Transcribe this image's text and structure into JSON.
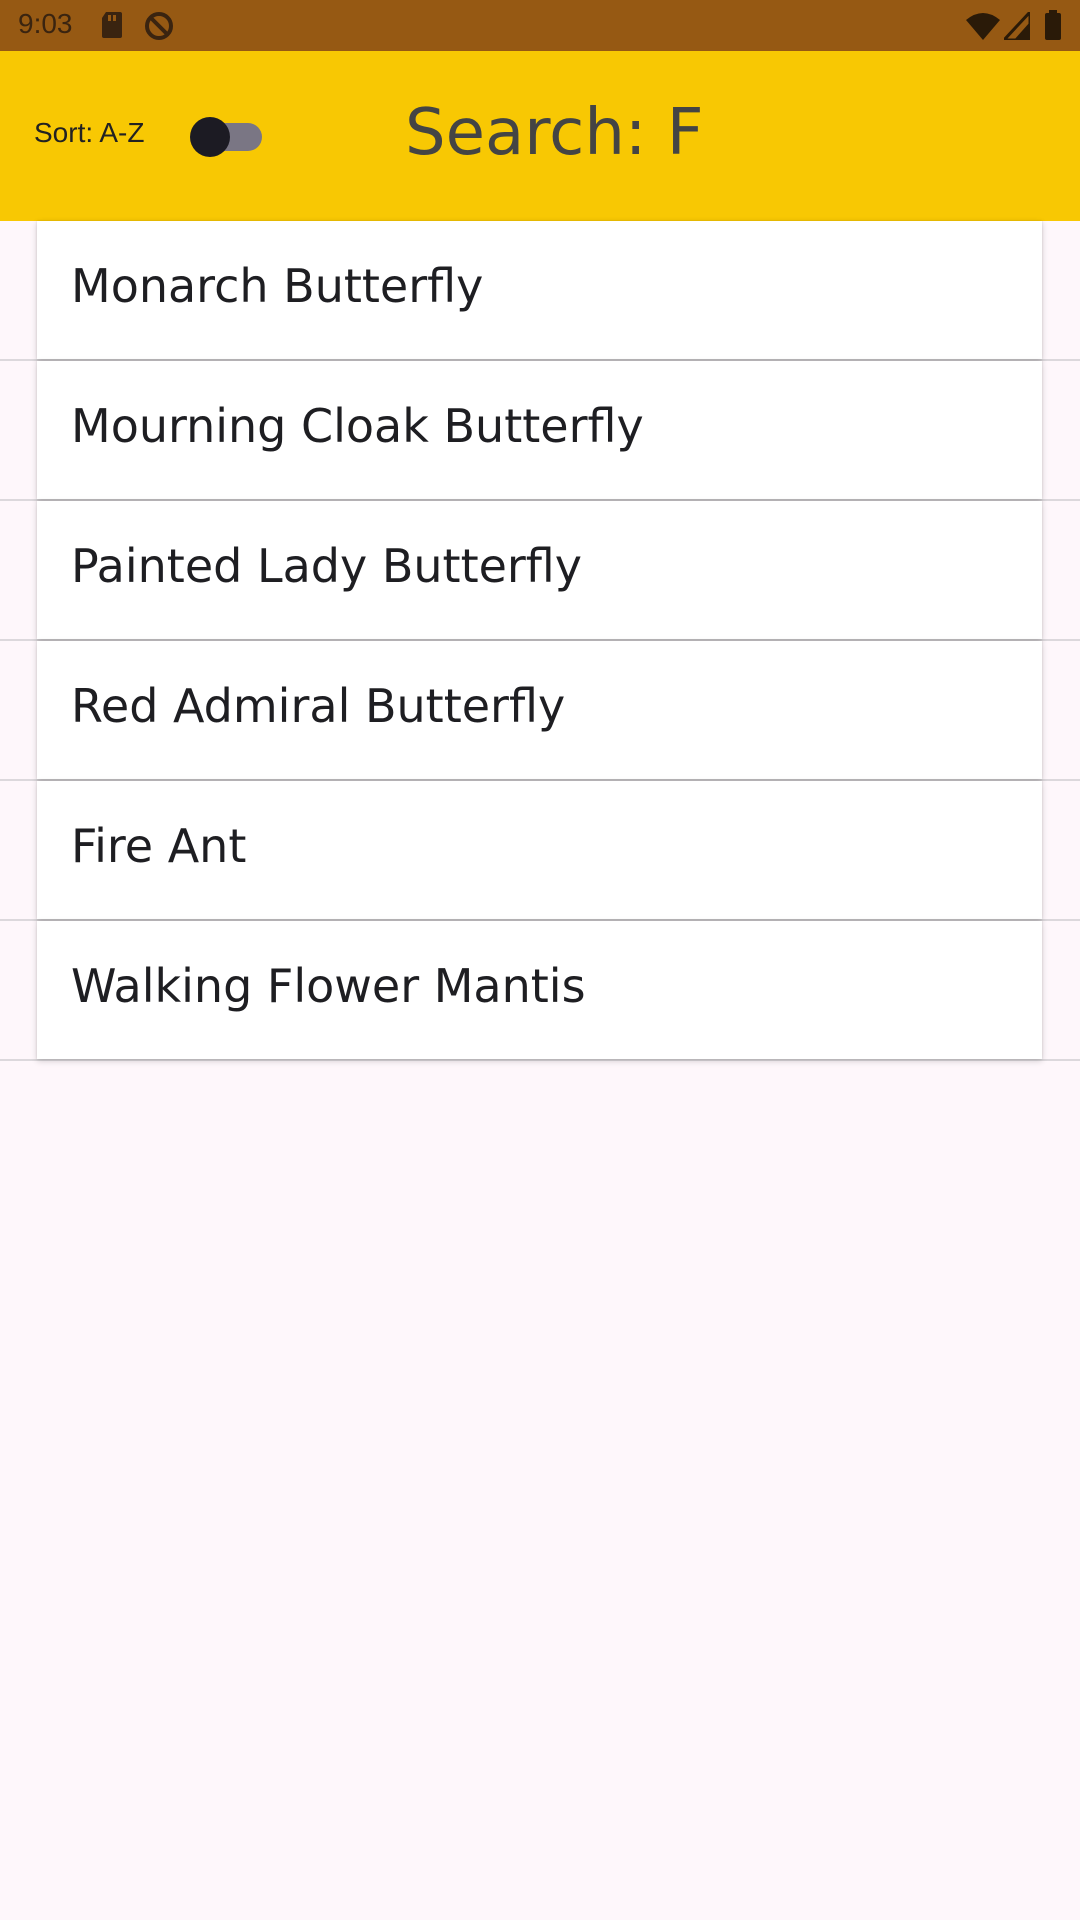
{
  "status_bar": {
    "time": "9:03",
    "icons": [
      "sd-card-icon",
      "do-not-disturb-icon",
      "wifi-icon",
      "signal-icon",
      "battery-icon"
    ]
  },
  "app_bar": {
    "sort_label": "Sort: A-Z",
    "sort_toggle_on": false,
    "title": "Search: F",
    "background_color": "#f8c803"
  },
  "results": [
    {
      "label": "Monarch Butterfly"
    },
    {
      "label": "Mourning Cloak Butterfly"
    },
    {
      "label": "Painted Lady Butterfly"
    },
    {
      "label": "Red Admiral Butterfly"
    },
    {
      "label": "Fire Ant"
    },
    {
      "label": "Walking Flower Mantis"
    }
  ]
}
